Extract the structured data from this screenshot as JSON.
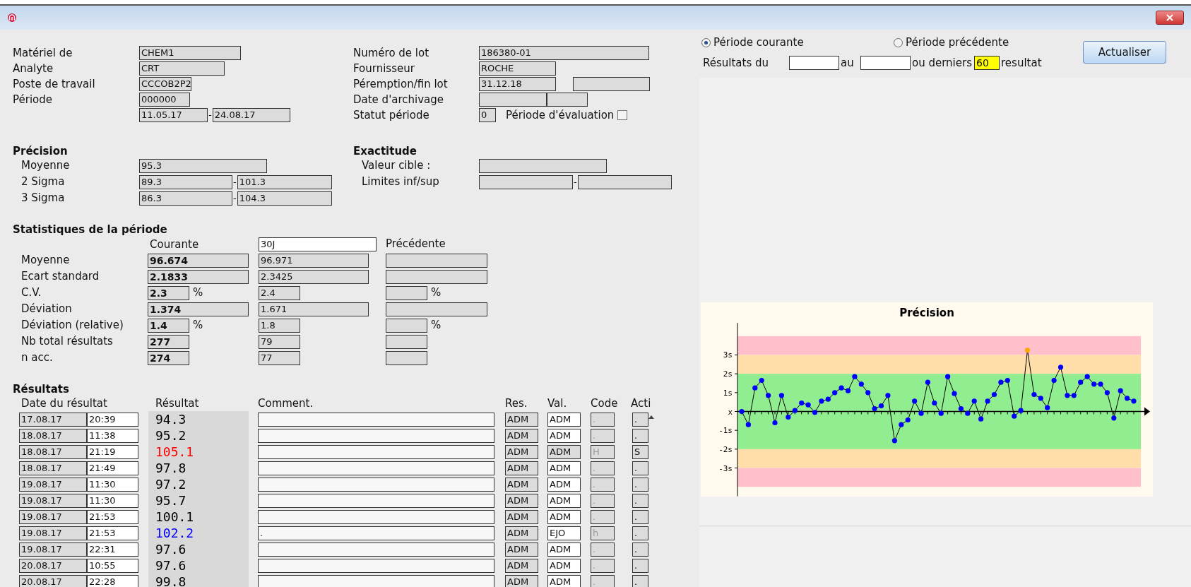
{
  "general_left": [
    {
      "label": "Matériel de",
      "fields": [
        {
          "value": "CHEM1"
        }
      ]
    },
    {
      "label": "Analyte",
      "fields": [
        {
          "value": "CRT"
        }
      ]
    },
    {
      "label": "Poste de travail",
      "fields": [
        {
          "value": "CCCOB2P2"
        }
      ]
    },
    {
      "label": "Période",
      "fields": [
        {
          "value": "000000"
        }
      ]
    },
    {
      "fields": [
        {
          "value": "11.05.17"
        },
        {
          "value": "24.08.17"
        }
      ],
      "separator": "-"
    }
  ],
  "general_right": [
    {
      "label": "Numéro de lot",
      "fields": [
        {
          "value": "186380-01"
        }
      ]
    },
    {
      "label": "Fournisseur",
      "fields": [
        {
          "value": "ROCHE"
        }
      ]
    },
    {
      "label": "Péremption/fin lot",
      "fields": [
        {
          "value": "31.12.18"
        }
      ]
    },
    {
      "label": "Date d'archivage"
    },
    {
      "label": "Statut période",
      "fields": [
        {
          "value": "0"
        }
      ],
      "checkbox": {
        "label": "Période d'évaluation",
        "checked": false
      }
    }
  ],
  "precision": {
    "title": "Précision",
    "rows": [
      {
        "label": "Moyenne",
        "fields": [
          {
            "value": "95.3"
          }
        ]
      },
      {
        "label": "2 Sigma",
        "fields": [
          {
            "value": "89.3"
          },
          {
            "value": "101.3"
          }
        ],
        "separator": "-"
      },
      {
        "label": "3 Sigma",
        "fields": [
          {
            "value": "86.3"
          },
          {
            "value": "104.3"
          }
        ],
        "separator": "-"
      }
    ]
  },
  "accuracy": {
    "title": "Exactitude",
    "rows": [
      {
        "label": "Valeur cible :"
      },
      {
        "label": "Limites inf/sup",
        "separator": "-"
      }
    ]
  },
  "stats": {
    "title": "Statistiques de la période",
    "col_current": "Courante",
    "period_field": "30J",
    "col_previous": "Précédente",
    "rows": [
      {
        "label": "Moyenne",
        "kind": "wide",
        "current": "96.674",
        "other": "96.971"
      },
      {
        "label": "Ecart standard",
        "kind": "wide",
        "current": "2.1833",
        "other": "2.3425"
      },
      {
        "label": "C.V.",
        "kind": "narrow",
        "current": "2.3",
        "current_unit": "%",
        "other": "2.4",
        "previous_unit": "%"
      },
      {
        "label": "Déviation",
        "kind": "wide",
        "current": "1.374",
        "other": "1.671"
      },
      {
        "label": "Déviation (relative)",
        "kind": "narrow",
        "current": "1.4",
        "current_unit": "%",
        "other": "1.8",
        "previous_unit": "%"
      },
      {
        "label": "Nb total résultats",
        "kind": "narrow",
        "current": "277",
        "other": "79"
      },
      {
        "label": "n acc.",
        "kind": "narrow",
        "current": "274",
        "other": "77"
      }
    ]
  },
  "results": {
    "title": "Résultats",
    "columns": [
      "Date du résultat",
      "Résultat",
      "Comment.",
      "Res.",
      "Val.",
      "Code",
      "Acti"
    ],
    "rows": [
      {
        "date": "17.08.17",
        "time": "20:39",
        "result": "94.3",
        "color": "#000000",
        "res": "ADM",
        "val": "ADM",
        "val_disabled": false,
        "code": ".",
        "action": "."
      },
      {
        "date": "18.08.17",
        "time": "11:38",
        "result": "95.2",
        "color": "#000000",
        "res": "ADM",
        "val": "ADM",
        "val_disabled": false,
        "code": ".",
        "action": "."
      },
      {
        "date": "18.08.17",
        "time": "21:19",
        "result": "105.1",
        "color": "#ff0000",
        "res": "ADM",
        "val": "ADM",
        "val_disabled": true,
        "code": "H",
        "action": "S"
      },
      {
        "date": "18.08.17",
        "time": "21:49",
        "result": "97.8",
        "color": "#000000",
        "res": "ADM",
        "val": "ADM",
        "val_disabled": false,
        "code": ".",
        "action": "."
      },
      {
        "date": "19.08.17",
        "time": "11:30",
        "result": "97.2",
        "color": "#000000",
        "res": "ADM",
        "val": "ADM",
        "val_disabled": false,
        "code": ".",
        "action": "."
      },
      {
        "date": "19.08.17",
        "time": "11:30",
        "result": "95.7",
        "color": "#000000",
        "res": "ADM",
        "val": "ADM",
        "val_disabled": false,
        "code": ".",
        "action": "."
      },
      {
        "date": "19.08.17",
        "time": "21:53",
        "result": "100.1",
        "color": "#000000",
        "res": "ADM",
        "val": "ADM",
        "val_disabled": false,
        "code": ".",
        "action": "."
      },
      {
        "date": "19.08.17",
        "time": "21:53",
        "result": "102.2",
        "color": "#0000ff",
        "comment": ".",
        "res": "ADM",
        "val": "EJO",
        "val_disabled": false,
        "code": "h",
        "action": "."
      },
      {
        "date": "19.08.17",
        "time": "22:31",
        "result": "97.6",
        "color": "#000000",
        "res": "ADM",
        "val": "ADM",
        "val_disabled": false,
        "code": ".",
        "action": "."
      },
      {
        "date": "20.08.17",
        "time": "10:55",
        "result": "97.6",
        "color": "#000000",
        "res": "ADM",
        "val": "ADM",
        "val_disabled": false,
        "code": ".",
        "action": "."
      },
      {
        "date": "20.08.17",
        "time": "22:28",
        "result": "99.8",
        "color": "#000000",
        "res": "ADM",
        "val": "ADM",
        "val_disabled": false,
        "code": ".",
        "action": "."
      }
    ]
  },
  "selection": {
    "period_options": [
      {
        "label": "Période courante",
        "selected": true
      },
      {
        "label": "Période précédente",
        "selected": false
      }
    ],
    "refresh_button": "Actualiser",
    "from_label": "Résultats du",
    "to_label": "au",
    "last_label": "ou derniers",
    "last_count": "60",
    "suffix": "resultat"
  },
  "chart": {
    "chart_data": {
      "type": "line",
      "title": "Précision",
      "ylim": [
        -4.5,
        4.7
      ],
      "yticks": [
        {
          "value": 3,
          "label": "3s"
        },
        {
          "value": 2,
          "label": "2s"
        },
        {
          "value": 1,
          "label": "1s"
        },
        {
          "value": 0,
          "label": "x"
        },
        {
          "value": -1,
          "label": "-1s"
        },
        {
          "value": -2,
          "label": "-2s"
        },
        {
          "value": -3,
          "label": "-3s"
        }
      ],
      "bands": [
        {
          "axis": "y",
          "from": 3,
          "to": 4,
          "color": "#ffc0cb"
        },
        {
          "axis": "y",
          "from": 2,
          "to": 3,
          "color": "#ffdeaa"
        },
        {
          "axis": "y",
          "from": -2,
          "to": 2,
          "color": "#90ee90"
        },
        {
          "axis": "y",
          "from": -3,
          "to": -2,
          "color": "#ffdeaa"
        },
        {
          "axis": "y",
          "from": -4,
          "to": -3,
          "color": "#ffc0cb"
        }
      ],
      "series": [
        {
          "color": "#0000ff",
          "marker": true,
          "values": [
            0,
            -0.7,
            1.25,
            1.65,
            0.85,
            -0.6,
            0.85,
            -0.3,
            0.05,
            0.45,
            0.35,
            -0.05,
            0.55,
            0.65,
            1.0,
            1.25,
            1.1,
            1.85,
            1.45,
            1.0,
            0.15,
            0.3,
            0.85,
            -1.55,
            -0.7,
            -0.45,
            0.55,
            -0.1,
            1.55,
            0.45,
            -0.1,
            1.85,
            0.95,
            0.15,
            -0.1,
            0.55,
            -0.4,
            0.55,
            0.9,
            1.55,
            1.65,
            -0.25,
            0.05,
            3.25,
            0.9,
            0.7,
            0.2,
            1.65,
            2.35,
            0.85,
            0.85,
            1.55,
            1.85,
            1.45,
            1.45,
            1.0,
            -0.35,
            1.1,
            0.7,
            0.55
          ]
        }
      ]
    }
  }
}
